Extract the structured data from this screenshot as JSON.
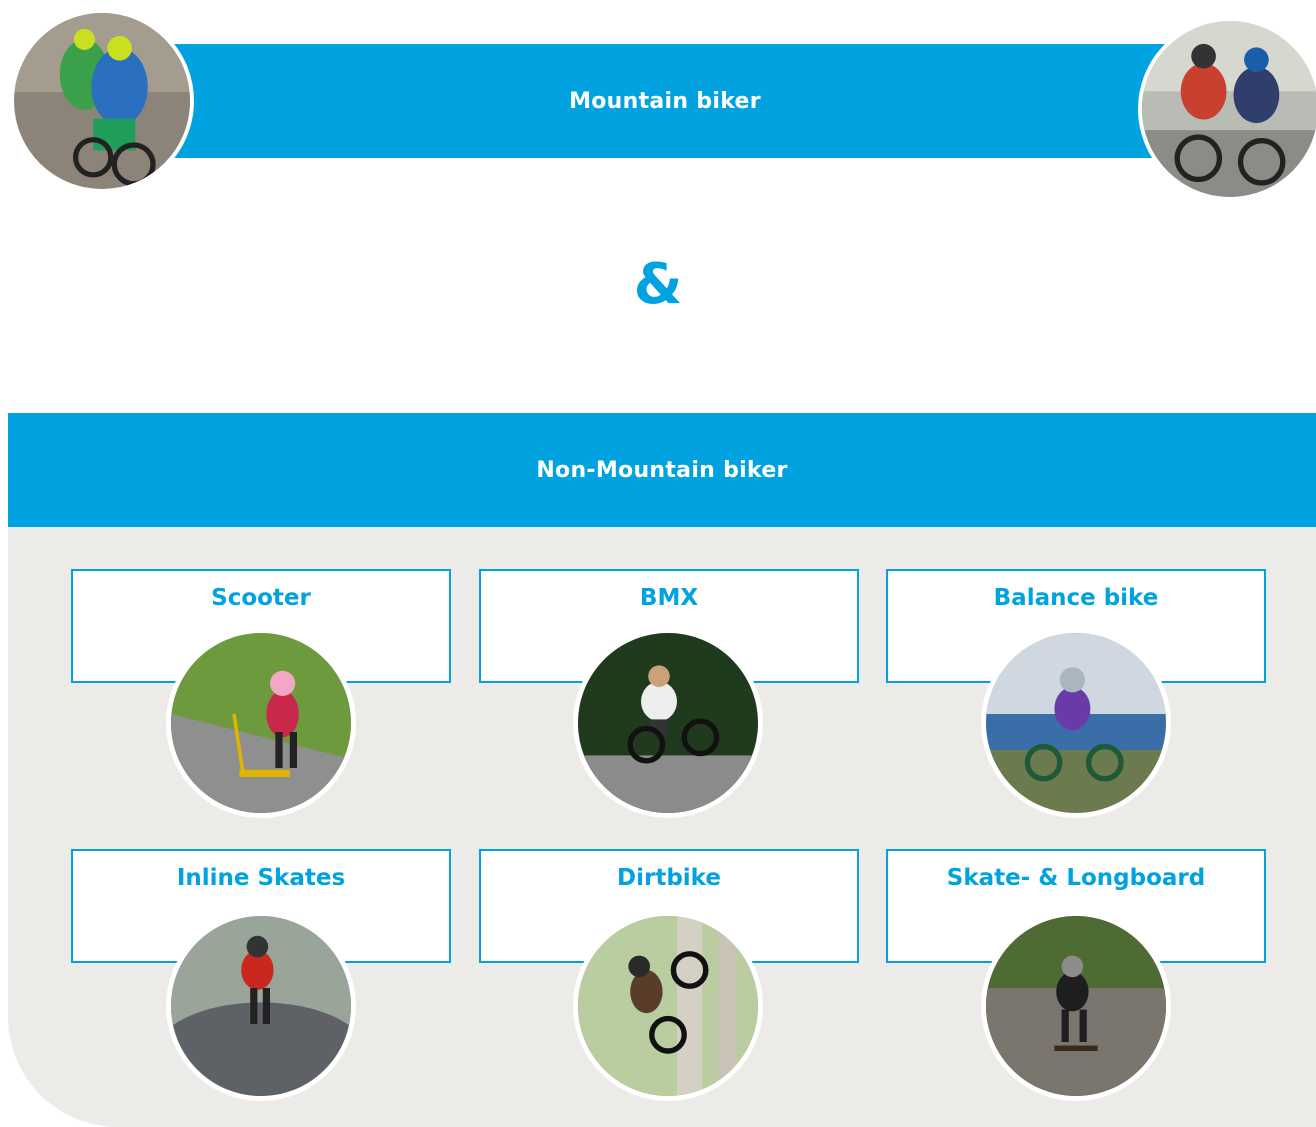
{
  "top": {
    "title": "Mountain biker"
  },
  "connector": "&",
  "non_mountain": {
    "title": "Non-Mountain biker",
    "items": [
      {
        "label": "Scooter"
      },
      {
        "label": "BMX"
      },
      {
        "label": "Balance bike"
      },
      {
        "label": "Inline Skates"
      },
      {
        "label": "Dirtbike"
      },
      {
        "label": "Skate- & Longboard"
      }
    ]
  },
  "colors": {
    "accent": "#00a3e0",
    "panel": "#ecebe8"
  }
}
